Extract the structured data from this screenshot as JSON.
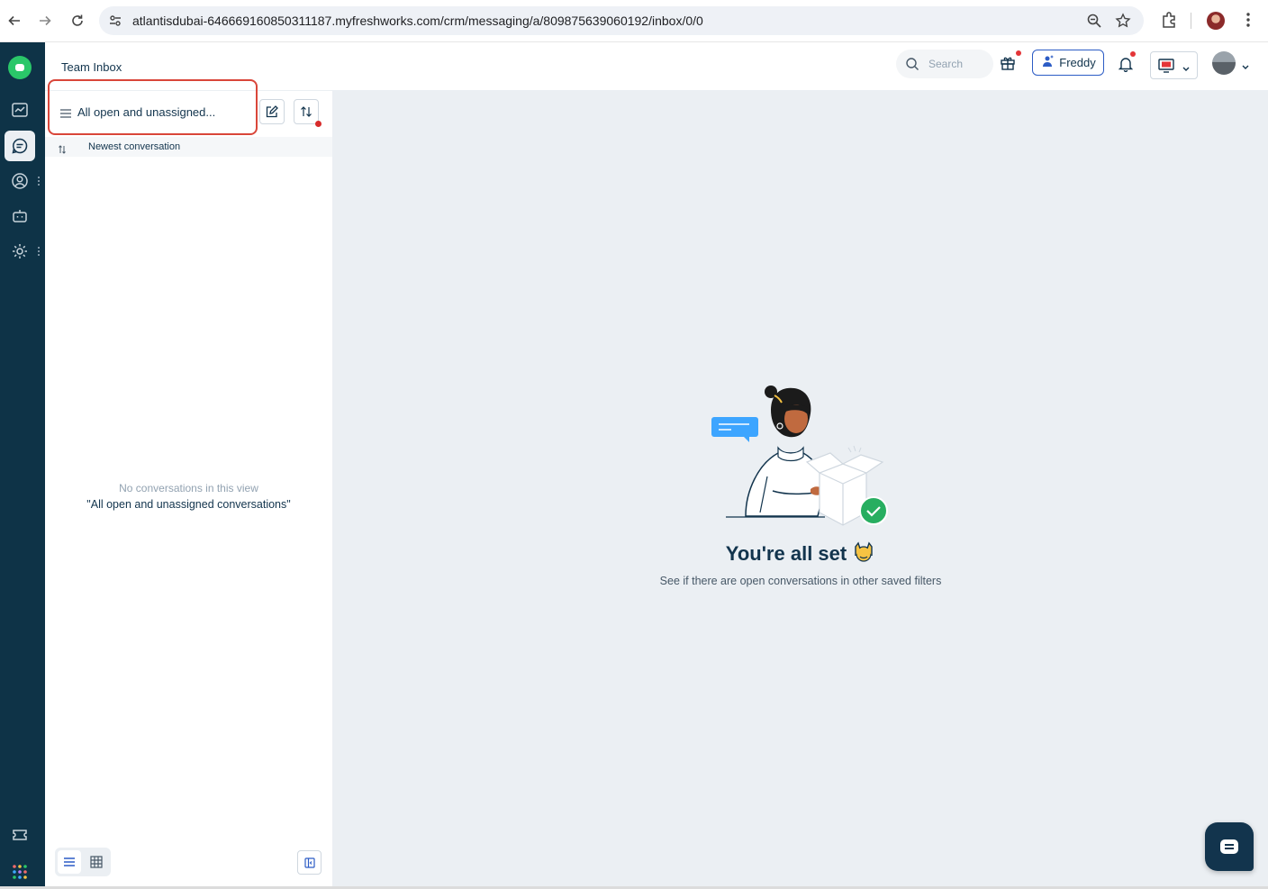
{
  "browser": {
    "url": "atlantisdubai-646669160850311187.myfreshworks.com/crm/messaging/a/809875639060192/inbox/0/0"
  },
  "header": {
    "title": "Team Inbox",
    "search_placeholder": "Search",
    "freddy_label": "Freddy"
  },
  "list": {
    "filter_label": "All open and unassigned...",
    "sort_label": "Newest conversation",
    "empty_line1": "No conversations in this view",
    "empty_line2": "\"All open and unassigned conversations\""
  },
  "main": {
    "title": "You're all set",
    "subtitle": "See if there are open conversations in other saved filters"
  },
  "colors": {
    "rail": "#0e3347",
    "accent": "#2c5cc5",
    "brand_green": "#2ac769",
    "highlight_border": "#d9463a",
    "main_bg": "#ebeff3"
  },
  "icons": {
    "rail": [
      "freshworks-logo",
      "deals-icon",
      "inbox-icon",
      "contacts-icon",
      "bot-icon",
      "settings-icon",
      "ticket-icon",
      "apps-grid-icon"
    ]
  }
}
